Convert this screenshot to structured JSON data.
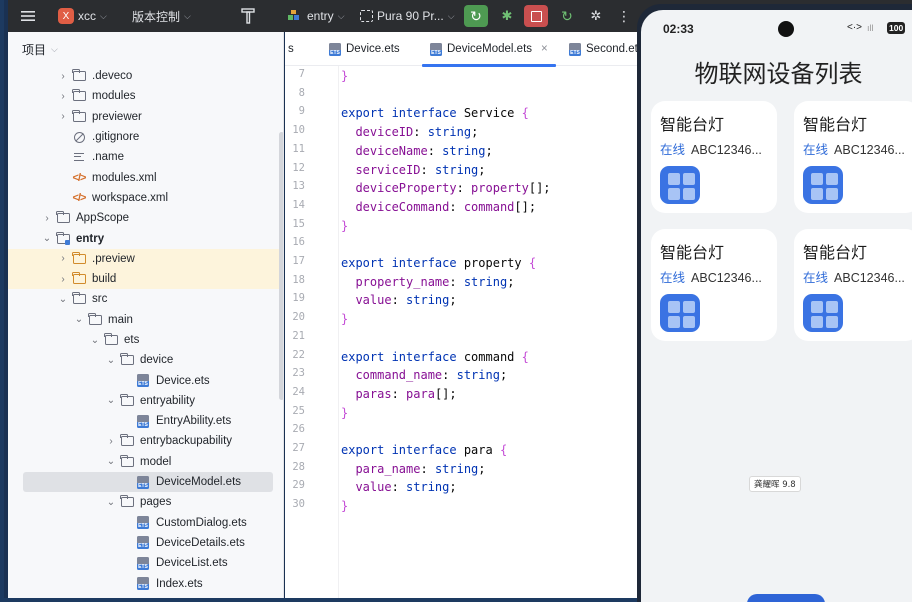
{
  "toolbar": {
    "project_badge": "X",
    "project_name": "xcc",
    "vcs_label": "版本控制",
    "module_label": "entry",
    "device_label": "Pura 90 Pr..."
  },
  "project_panel": {
    "title": "项目",
    "tree": [
      {
        "label": ".deveco",
        "icon": "folder",
        "arrow": "›",
        "depth": 2
      },
      {
        "label": "modules",
        "icon": "folder",
        "arrow": "›",
        "depth": 2
      },
      {
        "label": "previewer",
        "icon": "folder",
        "arrow": "›",
        "depth": 2
      },
      {
        "label": ".gitignore",
        "icon": "ignore",
        "arrow": "",
        "depth": 2
      },
      {
        "label": ".name",
        "icon": "name",
        "arrow": "",
        "depth": 2
      },
      {
        "label": "modules.xml",
        "icon": "xml",
        "arrow": "",
        "depth": 2
      },
      {
        "label": "workspace.xml",
        "icon": "xml",
        "arrow": "",
        "depth": 2
      },
      {
        "label": "AppScope",
        "icon": "folder",
        "arrow": "›",
        "depth": 1
      },
      {
        "label": "entry",
        "icon": "module",
        "arrow": "⌄",
        "depth": 1,
        "bold": true
      },
      {
        "label": ".preview",
        "icon": "folder-orange",
        "arrow": "›",
        "depth": 2,
        "highlight": true
      },
      {
        "label": "build",
        "icon": "folder-orange",
        "arrow": "›",
        "depth": 2,
        "highlight": true
      },
      {
        "label": "src",
        "icon": "folder",
        "arrow": "⌄",
        "depth": 2
      },
      {
        "label": "main",
        "icon": "folder",
        "arrow": "⌄",
        "depth": 3
      },
      {
        "label": "ets",
        "icon": "folder",
        "arrow": "⌄",
        "depth": 4
      },
      {
        "label": "device",
        "icon": "folder",
        "arrow": "⌄",
        "depth": 5
      },
      {
        "label": "Device.ets",
        "icon": "ets",
        "arrow": "",
        "depth": 6
      },
      {
        "label": "entryability",
        "icon": "folder",
        "arrow": "⌄",
        "depth": 5
      },
      {
        "label": "EntryAbility.ets",
        "icon": "ets",
        "arrow": "",
        "depth": 6
      },
      {
        "label": "entrybackupability",
        "icon": "folder",
        "arrow": "›",
        "depth": 5
      },
      {
        "label": "model",
        "icon": "folder",
        "arrow": "⌄",
        "depth": 5
      },
      {
        "label": "DeviceModel.ets",
        "icon": "ets",
        "arrow": "",
        "depth": 6,
        "selected": true
      },
      {
        "label": "pages",
        "icon": "folder",
        "arrow": "⌄",
        "depth": 5
      },
      {
        "label": "CustomDialog.ets",
        "icon": "ets",
        "arrow": "",
        "depth": 6
      },
      {
        "label": "DeviceDetails.ets",
        "icon": "ets",
        "arrow": "",
        "depth": 6
      },
      {
        "label": "DeviceList.ets",
        "icon": "ets",
        "arrow": "",
        "depth": 6
      },
      {
        "label": "Index.ets",
        "icon": "ets",
        "arrow": "",
        "depth": 6
      }
    ]
  },
  "editor": {
    "tabs": [
      {
        "label": "s",
        "icon": false,
        "active": false,
        "close": false
      },
      {
        "label": "Device.ets",
        "icon": true,
        "active": false,
        "close": false
      },
      {
        "label": "DeviceModel.ets",
        "icon": true,
        "active": true,
        "close": true
      },
      {
        "label": "Second.ets",
        "icon": true,
        "active": false,
        "close": false
      }
    ],
    "close_glyph": "×",
    "lines": [
      {
        "n": "7",
        "tokens": [
          [
            "br",
            "}"
          ]
        ]
      },
      {
        "n": "8",
        "tokens": []
      },
      {
        "n": "9",
        "tokens": [
          [
            "kw",
            "export interface "
          ],
          [
            "pu",
            "Service "
          ],
          [
            "br",
            "{"
          ]
        ]
      },
      {
        "n": "10",
        "tokens": [
          [
            "ty",
            "  deviceID"
          ],
          [
            "pu",
            ": "
          ],
          [
            "kw",
            "string"
          ],
          [
            "pu",
            ";"
          ]
        ]
      },
      {
        "n": "11",
        "tokens": [
          [
            "ty",
            "  deviceName"
          ],
          [
            "pu",
            ": "
          ],
          [
            "kw",
            "string"
          ],
          [
            "pu",
            ";"
          ]
        ]
      },
      {
        "n": "12",
        "tokens": [
          [
            "ty",
            "  serviceID"
          ],
          [
            "pu",
            ": "
          ],
          [
            "kw",
            "string"
          ],
          [
            "pu",
            ";"
          ]
        ]
      },
      {
        "n": "13",
        "tokens": [
          [
            "ty",
            "  deviceProperty"
          ],
          [
            "pu",
            ": "
          ],
          [
            "ty",
            "property"
          ],
          [
            "pu",
            "[];"
          ]
        ]
      },
      {
        "n": "14",
        "tokens": [
          [
            "ty",
            "  deviceCommand"
          ],
          [
            "pu",
            ": "
          ],
          [
            "ty",
            "command"
          ],
          [
            "pu",
            "[];"
          ]
        ]
      },
      {
        "n": "15",
        "tokens": [
          [
            "br",
            "}"
          ]
        ]
      },
      {
        "n": "16",
        "tokens": []
      },
      {
        "n": "17",
        "tokens": [
          [
            "kw",
            "export interface "
          ],
          [
            "pu",
            "property "
          ],
          [
            "br",
            "{"
          ]
        ]
      },
      {
        "n": "18",
        "tokens": [
          [
            "ty",
            "  property_name"
          ],
          [
            "pu",
            ": "
          ],
          [
            "kw",
            "string"
          ],
          [
            "pu",
            ";"
          ]
        ]
      },
      {
        "n": "19",
        "tokens": [
          [
            "ty",
            "  value"
          ],
          [
            "pu",
            ": "
          ],
          [
            "kw",
            "string"
          ],
          [
            "pu",
            ";"
          ]
        ]
      },
      {
        "n": "20",
        "tokens": [
          [
            "br",
            "}"
          ]
        ]
      },
      {
        "n": "21",
        "tokens": []
      },
      {
        "n": "22",
        "tokens": [
          [
            "kw",
            "export interface "
          ],
          [
            "pu",
            "command "
          ],
          [
            "br",
            "{"
          ]
        ]
      },
      {
        "n": "23",
        "tokens": [
          [
            "ty",
            "  command_name"
          ],
          [
            "pu",
            ": "
          ],
          [
            "kw",
            "string"
          ],
          [
            "pu",
            ";"
          ]
        ]
      },
      {
        "n": "24",
        "tokens": [
          [
            "ty",
            "  paras"
          ],
          [
            "pu",
            ": "
          ],
          [
            "ty",
            "para"
          ],
          [
            "pu",
            "[];"
          ]
        ]
      },
      {
        "n": "25",
        "tokens": [
          [
            "br",
            "}"
          ]
        ]
      },
      {
        "n": "26",
        "tokens": []
      },
      {
        "n": "27",
        "tokens": [
          [
            "kw",
            "export interface "
          ],
          [
            "pu",
            "para "
          ],
          [
            "br",
            "{"
          ]
        ]
      },
      {
        "n": "28",
        "tokens": [
          [
            "ty",
            "  para_name"
          ],
          [
            "pu",
            ": "
          ],
          [
            "kw",
            "string"
          ],
          [
            "pu",
            ";"
          ]
        ]
      },
      {
        "n": "29",
        "tokens": [
          [
            "ty",
            "  value"
          ],
          [
            "pu",
            ": "
          ],
          [
            "kw",
            "string"
          ],
          [
            "pu",
            ";"
          ]
        ]
      },
      {
        "n": "30",
        "tokens": [
          [
            "br",
            "}"
          ]
        ]
      }
    ]
  },
  "phone": {
    "time": "02:33",
    "battery": "100",
    "signal": "<·>",
    "title": "物联网设备列表",
    "cards": [
      {
        "name": "智能台灯",
        "status": "在线",
        "device_id": "ABC12346..."
      },
      {
        "name": "智能台灯",
        "status": "在线",
        "device_id": "ABC12346..."
      },
      {
        "name": "智能台灯",
        "status": "在线",
        "device_id": "ABC12346..."
      },
      {
        "name": "智能台灯",
        "status": "在线",
        "device_id": "ABC12346..."
      }
    ],
    "author_tag": "龚耀晖 9.8"
  },
  "colors": {
    "accent": "#3574f0",
    "online": "#2f6bd8",
    "device_icon": "#3a73e3"
  }
}
